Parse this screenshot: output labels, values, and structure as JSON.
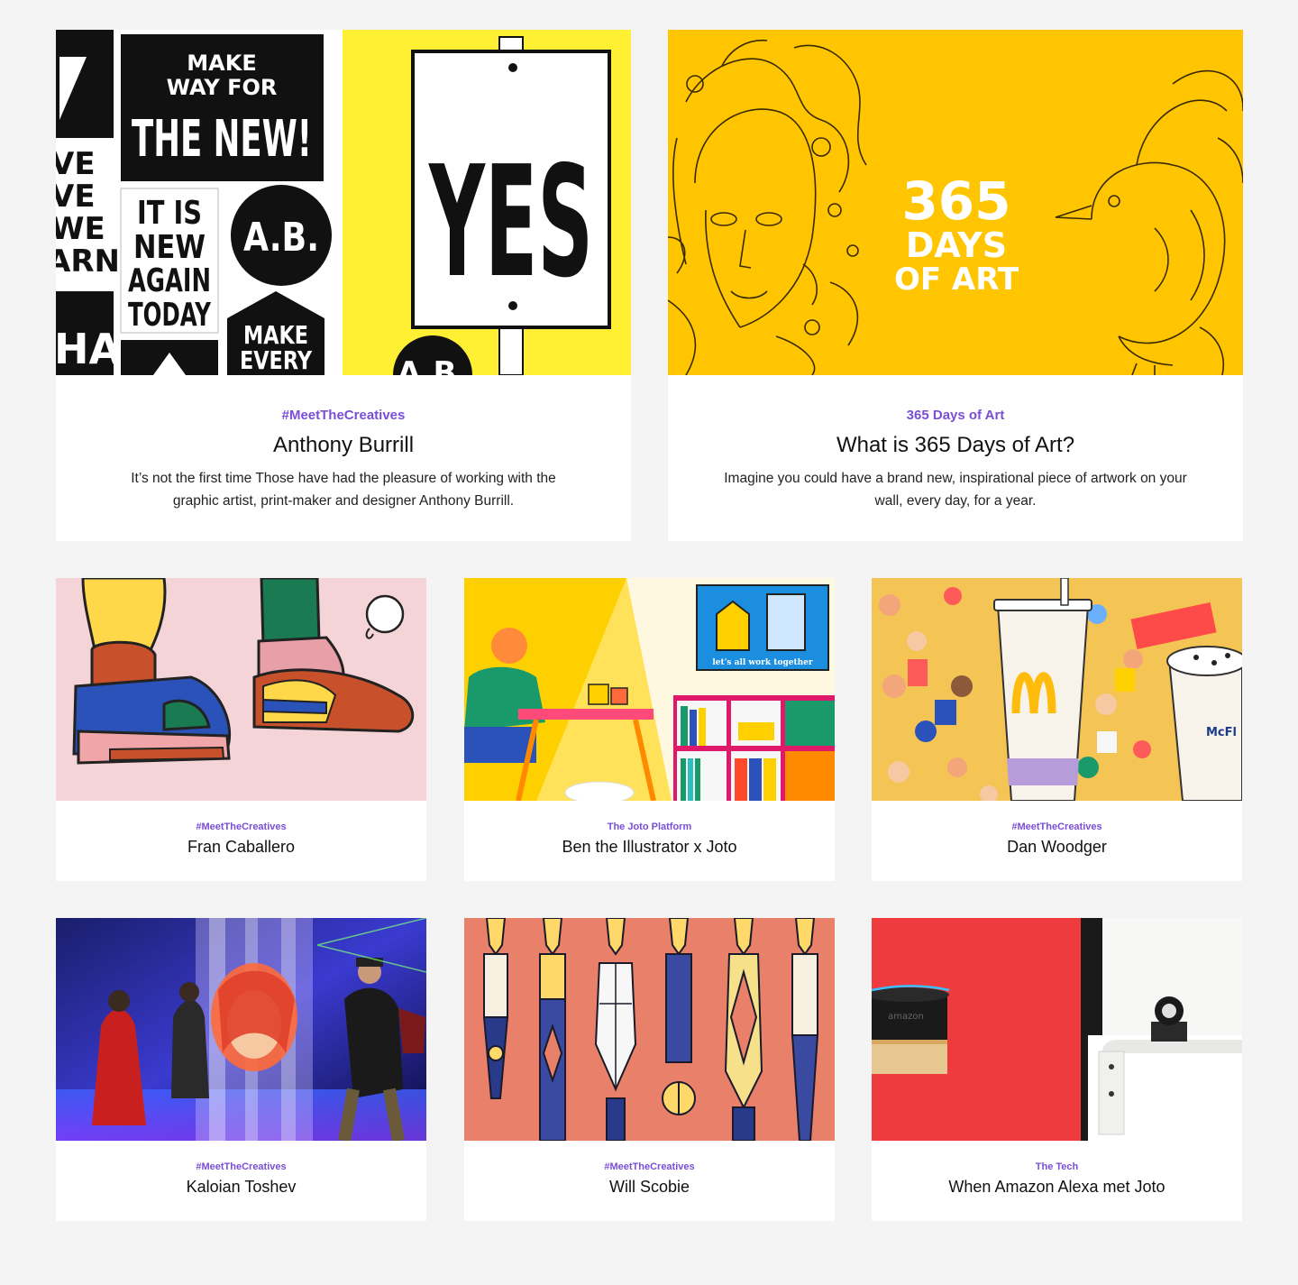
{
  "cards": [
    {
      "tag": "#MeetTheCreatives",
      "title": "Anthony Burrill",
      "description": "It’s not the first time Those have had the pleasure of working with the graphic artist, print-maker and designer Anthony Burrill.",
      "art": {
        "poster1_lines": [
          "MAKE",
          "WAY FOR",
          "THE NEW!"
        ],
        "poster2_lines": [
          "IT IS",
          "NEW",
          "AGAIN",
          "TODAY"
        ],
        "badge": "A.B.",
        "poster3_lines": [
          "MAKE",
          "EVERY"
        ],
        "edge_lines": [
          "VE",
          "VE",
          "WE",
          "ARN"
        ],
        "edge_bottom": "HAT",
        "sign": "YES",
        "sign_badge": "A.B."
      }
    },
    {
      "tag": "365 Days of Art",
      "title": "What is 365 Days of Art?",
      "description": "Imagine you could have a brand new, inspirational piece of artwork on your wall, every day, for a year.",
      "art": {
        "lines": [
          "365",
          "DAYS",
          "OF ART"
        ]
      }
    },
    {
      "tag": "#MeetTheCreatives",
      "title": "Fran Caballero"
    },
    {
      "tag": "The Joto Platform",
      "title": "Ben the Illustrator x Joto",
      "art": {
        "poster_caption": "let's all work together"
      }
    },
    {
      "tag": "#MeetTheCreatives",
      "title": "Dan Woodger",
      "art": {
        "cup_label": "McFl"
      }
    },
    {
      "tag": "#MeetTheCreatives",
      "title": "Kaloian Toshev"
    },
    {
      "tag": "#MeetTheCreatives",
      "title": "Will Scobie"
    },
    {
      "tag": "The Tech",
      "title": "When Amazon Alexa met Joto",
      "art": {
        "device_label": "amazon"
      }
    }
  ],
  "colors": {
    "tag": "#7a4ed6",
    "background": "#f5f4f5",
    "yellow_a": "#fff034",
    "yellow_b": "#ffc500",
    "pink": "#f5d4d8",
    "salmon": "#e8806a",
    "red": "#ef3a3e"
  }
}
